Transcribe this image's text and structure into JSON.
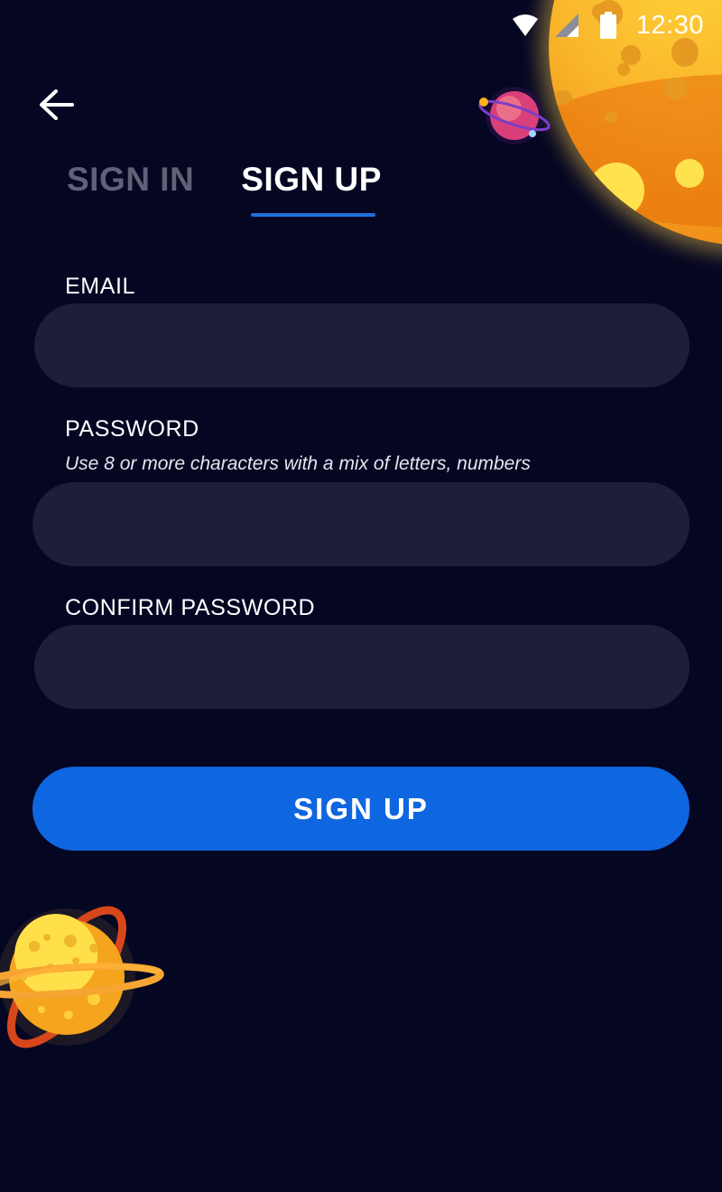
{
  "status_bar": {
    "time": "12:30",
    "icons": [
      "wifi-icon",
      "cell-signal-icon",
      "battery-icon"
    ]
  },
  "header": {
    "back_icon": "arrow-left-icon"
  },
  "tabs": [
    {
      "label": "SIGN IN",
      "active": false
    },
    {
      "label": "SIGN UP",
      "active": true
    }
  ],
  "form": {
    "email": {
      "label": "EMAIL",
      "value": "",
      "placeholder": ""
    },
    "password": {
      "label": "PASSWORD",
      "hint": "Use 8 or more characters with a mix of letters, numbers",
      "value": "",
      "placeholder": ""
    },
    "confirm_password": {
      "label": "CONFIRM PASSWORD",
      "value": "",
      "placeholder": ""
    },
    "submit_label": "SIGN UP"
  },
  "colors": {
    "background": "#050622",
    "input_background": "#1e1e38",
    "accent": "#0e66e0",
    "inactive_tab": "#5f6276"
  }
}
